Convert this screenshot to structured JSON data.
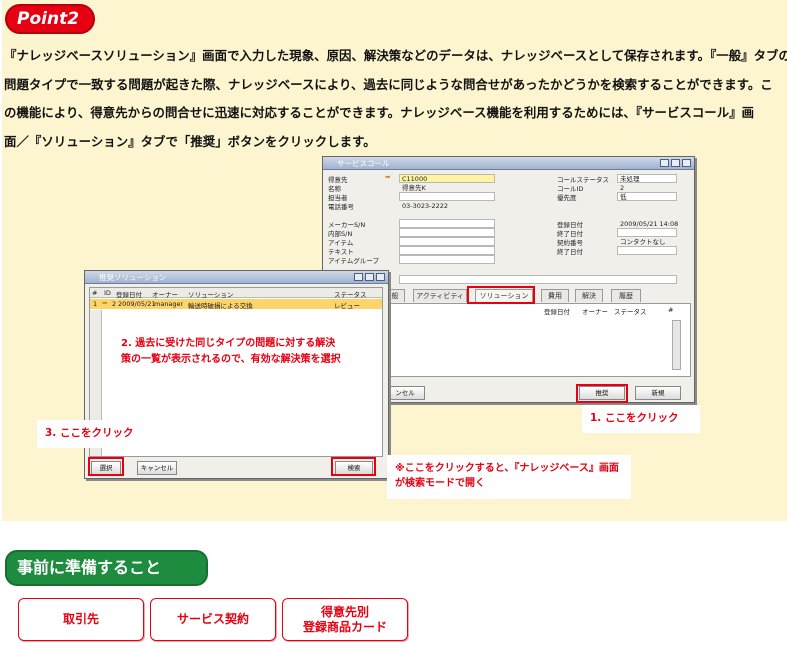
{
  "point_badge": "Point2",
  "description": [
    "『ナレッジベースソリューション』画面で入力した現象、原因、解決策などのデータは、ナレッジベースとして保存されます。『一般』タブの",
    "問題タイプで一致する問題が起きた際、ナレッジベースにより、過去に同じような問合せがあったかどうかを検索することができます。こ",
    "の機能により、得意先からの問合せに迅速に対応することができます。ナレッジベース機能を利用するためには、『サービスコール』画",
    "面／『ソリューション』タブで「推奨」ボタンをクリックします。"
  ],
  "service_call_window": {
    "title": "サービスコール",
    "fields_left": [
      {
        "label": "得意先",
        "value": "C11000"
      },
      {
        "label": "名称",
        "value": "得意先K"
      },
      {
        "label": "担当者",
        "value": ""
      },
      {
        "label": "電話番号",
        "value": "03-3023-2222"
      }
    ],
    "fields_left2": [
      {
        "label": "メーカーS/N",
        "value": ""
      },
      {
        "label": "内部S/N",
        "value": ""
      },
      {
        "label": "アイテム",
        "value": ""
      },
      {
        "label": "テキスト",
        "value": ""
      },
      {
        "label": "アイテムグループ",
        "value": ""
      }
    ],
    "fields_right": [
      {
        "label": "コールステータス",
        "value": "未処理"
      },
      {
        "label": "コールID",
        "value": "2"
      },
      {
        "label": "優先度",
        "value": "低"
      }
    ],
    "fields_right2": [
      {
        "label": "登録日付",
        "value": "2009/05/21 14:08"
      },
      {
        "label": "終了日付",
        "value": ""
      },
      {
        "label": "契約番号",
        "value": "コンタクトなし"
      },
      {
        "label": "終了日付",
        "value": ""
      }
    ],
    "tabs": [
      "般",
      "アクティビティ",
      "ソリューション",
      "費用",
      "解決",
      "履歴"
    ],
    "columns": [
      "登録日付",
      "オーナー",
      "ステータス",
      "#"
    ],
    "recommend_button": "推奨",
    "new_button": "新規",
    "cancel_partial": "ンセル"
  },
  "recommend_window": {
    "title": "推奨ソリューション",
    "columns": [
      "#",
      "ID",
      "登録日付",
      "オーナー",
      "ソリューション",
      "ステータス"
    ],
    "row": {
      "num": "1",
      "id": "2",
      "date": "2009/05/21",
      "owner": "manager",
      "solution": "輸送時破損による交換",
      "status": "レビュー"
    },
    "select_button": "選択",
    "cancel_button": "キャンセル",
    "search_button": "検索"
  },
  "callouts": {
    "step1": "1. ここをクリック",
    "step2": "2. 過去に受けた同じタイプの問題に対する解決策の一覧が表示されるので、有効な解決策を選択",
    "step3": "3. ここをクリック",
    "note": "※ここをクリックすると、『ナレッジベース』画面が検索モードで開く"
  },
  "section_title": "事前に準備すること",
  "prep_buttons": [
    "取引先",
    "サービス契約",
    "得意先別\n登録商品カード"
  ],
  "colors": {
    "accent_red": "#e60012",
    "section_green": "#1e8c3f",
    "panel_bg": "#fdf5cf"
  }
}
